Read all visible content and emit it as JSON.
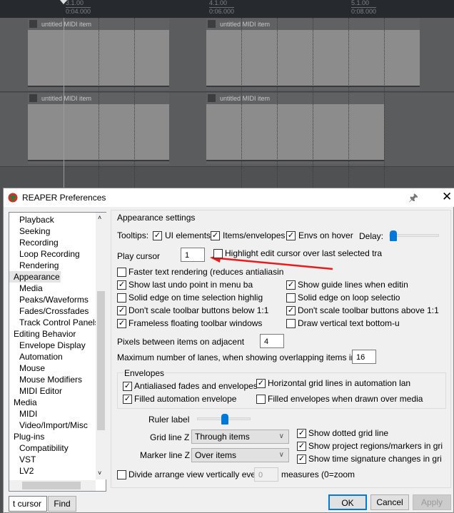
{
  "arrange": {
    "ruler": [
      {
        "measure": "3.1.00",
        "time": "0:04.000"
      },
      {
        "measure": "4.1.00",
        "time": "0:06.000"
      },
      {
        "measure": "5.1.00",
        "time": "0:08.000"
      }
    ],
    "item_label": "untitled MIDI item"
  },
  "dialog": {
    "title": "REAPER Preferences",
    "sidebar": [
      {
        "label": "Playback",
        "level": 1
      },
      {
        "label": "Seeking",
        "level": 1
      },
      {
        "label": "Recording",
        "level": 1
      },
      {
        "label": "Loop Recording",
        "level": 1
      },
      {
        "label": "Rendering",
        "level": 1
      },
      {
        "label": "Appearance",
        "level": 0,
        "selected": true
      },
      {
        "label": "Media",
        "level": 1
      },
      {
        "label": "Peaks/Waveforms",
        "level": 1
      },
      {
        "label": "Fades/Crossfades",
        "level": 1
      },
      {
        "label": "Track Control Panels",
        "level": 1
      },
      {
        "label": "Editing Behavior",
        "level": 0
      },
      {
        "label": "Envelope Display",
        "level": 1
      },
      {
        "label": "Automation",
        "level": 1
      },
      {
        "label": "Mouse",
        "level": 1
      },
      {
        "label": "Mouse Modifiers",
        "level": 1
      },
      {
        "label": "MIDI Editor",
        "level": 1
      },
      {
        "label": "Media",
        "level": 0
      },
      {
        "label": "MIDI",
        "level": 1
      },
      {
        "label": "Video/Import/Misc",
        "level": 1
      },
      {
        "label": "Plug-ins",
        "level": 0
      },
      {
        "label": "Compatibility",
        "level": 1
      },
      {
        "label": "VST",
        "level": 1
      },
      {
        "label": "LV2",
        "level": 1
      }
    ],
    "search_value": "t cursor",
    "find_label": "Find",
    "section_title": "Appearance settings",
    "tooltips_label": "Tooltips:",
    "tooltips": [
      {
        "label": "UI elements",
        "checked": true
      },
      {
        "label": "Items/envelopes",
        "checked": true
      },
      {
        "label": "Envs on hover",
        "checked": true
      }
    ],
    "delay_label": "Delay:",
    "delay_level": 0.0,
    "play_cursor_label": "Play cursor",
    "play_cursor_value": "1",
    "highlight_label": "Highlight edit cursor over last selected tra",
    "highlight_checked": false,
    "faster_text": {
      "label": "Faster text rendering (reduces antialiasin",
      "checked": false
    },
    "left_opts": [
      {
        "label": "Show last undo point in menu ba",
        "checked": true
      },
      {
        "label": "Solid edge on time selection highlig",
        "checked": false
      },
      {
        "label": "Don't scale toolbar buttons below 1:1",
        "checked": true
      },
      {
        "label": "Frameless floating toolbar windows",
        "checked": true
      }
    ],
    "right_opts": [
      {
        "label": "Show guide lines when editin",
        "checked": true
      },
      {
        "label": "Solid edge on loop selectio",
        "checked": false
      },
      {
        "label": "Don't scale toolbar buttons above 1:1",
        "checked": true
      },
      {
        "label": "Draw vertical text bottom-u",
        "checked": false
      }
    ],
    "pixels_label": "Pixels between items on adjacent",
    "pixels_value": "4",
    "lanes_label": "Maximum number of lanes, when showing overlapping items in",
    "lanes_value": "16",
    "envelopes_title": "Envelopes",
    "env_opts": [
      {
        "label": "Antialiased fades and envelopes",
        "checked": true
      },
      {
        "label": "Horizontal grid lines in automation lan",
        "checked": true
      },
      {
        "label": "Filled automation envelope",
        "checked": true
      },
      {
        "label": "Filled envelopes when drawn over media",
        "checked": false
      }
    ],
    "ruler_label": "Ruler label",
    "ruler_level": 0.5,
    "grid_z_label": "Grid line Z",
    "grid_z_value": "Through items",
    "marker_z_label": "Marker line Z",
    "marker_z_value": "Over items",
    "grid_opts": [
      {
        "label": "Show dotted grid line",
        "checked": true
      },
      {
        "label": "Show project regions/markers in gri",
        "checked": true
      },
      {
        "label": "Show time signature changes in gri",
        "checked": true
      }
    ],
    "divide_label": "Divide arrange view vertically ever",
    "divide_checked": false,
    "divide_value": "0",
    "measures_label": "measures (0=zoom",
    "ok": "OK",
    "cancel": "Cancel",
    "apply": "Apply",
    "annotation_color": "#e81c1c",
    "accent_color": "#0078d7"
  }
}
